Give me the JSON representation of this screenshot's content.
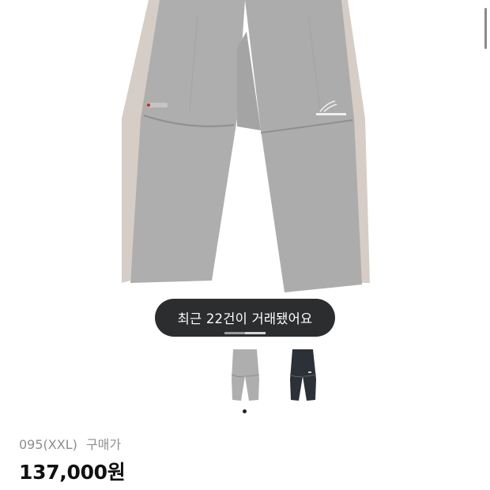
{
  "toast": {
    "text": "최근 22건이 거래됐어요"
  },
  "gallery": {
    "progress": 0.5,
    "selected_index": 1,
    "thumbnails": [
      "grey-pants-thumbnail",
      "black-pants-thumbnail"
    ]
  },
  "product": {
    "size": "095(XXL)",
    "price_label": "구매가",
    "price": "137,000원"
  },
  "colors": {
    "pants_main": "#aeaeae",
    "pants_side": "#d6cdc6",
    "toast_bg": "#2b2d2f",
    "thumb_black": "#2c3138"
  },
  "icons": {
    "logo": "the-north-face-logo"
  }
}
